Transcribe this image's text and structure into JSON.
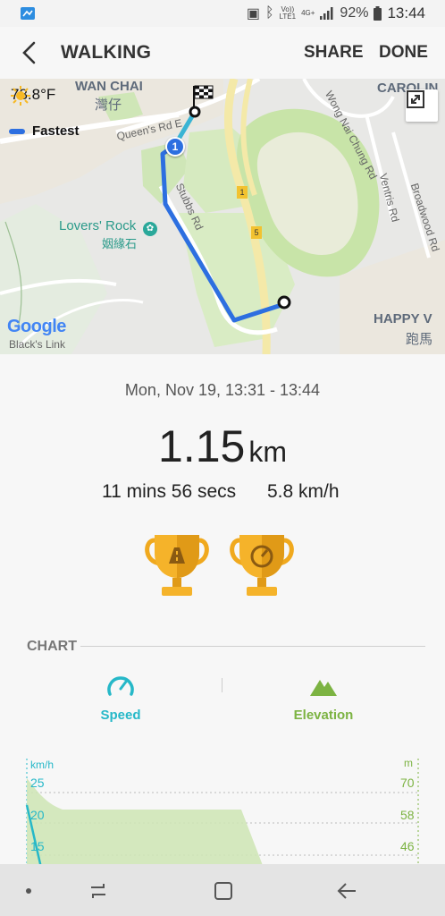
{
  "status_bar": {
    "network_labels": [
      "Vo))",
      "LTE1",
      "4G+"
    ],
    "battery": "92%",
    "time": "13:44"
  },
  "header": {
    "title": "WALKING",
    "share": "SHARE",
    "done": "DONE"
  },
  "map": {
    "temperature": "78.8°F",
    "route_label": "Fastest",
    "labels": {
      "wan_chai": "WAN CHAI",
      "wan_chai_zh": "灣仔",
      "queens_rd": "Queen's Rd E",
      "lovers_rock": "Lovers' Rock",
      "lovers_rock_zh": "姻緣石",
      "stubbs_rd": "Stubbs Rd",
      "wong_nai_chung": "Wong Nai Chung Rd",
      "ventris": "Ventris Rd",
      "broadwood": "Broadwood Rd",
      "caroline": "CAROLIN",
      "happy_valley": "HAPPY V",
      "happy_valley_zh": "跑馬",
      "blacks_link": "Black's Link",
      "google": "Google",
      "marker_1": "1",
      "road_1": "1",
      "road_5": "5"
    },
    "colors": {
      "route": "#2d6fe0",
      "start_segment": "#3ab4d4"
    }
  },
  "summary": {
    "date": "Mon, Nov 19, 13:31 - 13:44",
    "distance_value": "1.15",
    "distance_unit": "km",
    "duration": "11 mins 56 secs",
    "speed": "5.8 km/h"
  },
  "chart": {
    "heading": "CHART",
    "tabs": [
      {
        "label": "Speed",
        "icon": "speedometer-icon",
        "color": "#26b8c8"
      },
      {
        "label": "Elevation",
        "icon": "mountain-icon",
        "color": "#7cb342"
      }
    ],
    "left_unit": "km/h",
    "right_unit": "m",
    "left_ticks": [
      "25",
      "20",
      "15"
    ],
    "right_ticks": [
      "70",
      "58",
      "46"
    ]
  },
  "nav": {
    "icons": [
      "dot-icon",
      "recents-icon",
      "home-icon",
      "back-arrow-icon"
    ]
  }
}
